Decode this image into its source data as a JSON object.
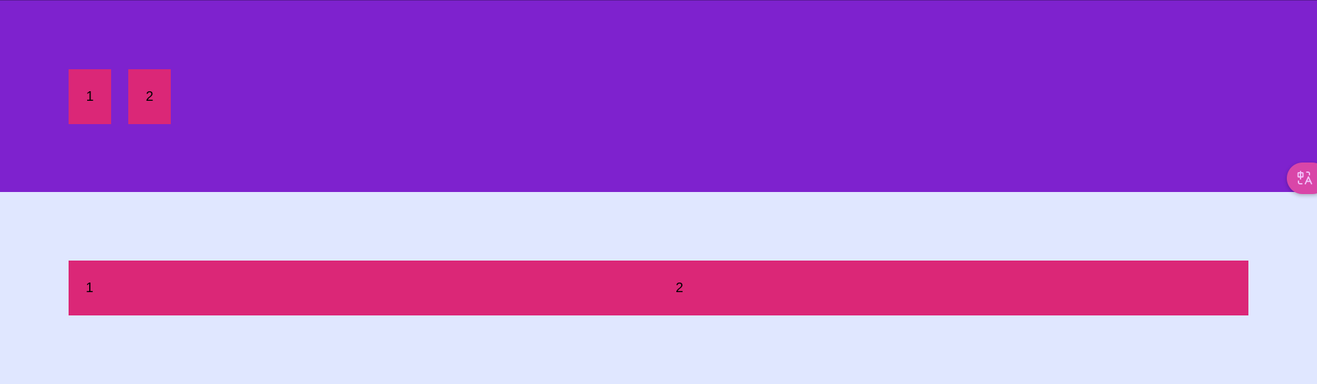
{
  "top_section": {
    "items": [
      {
        "label": "1"
      },
      {
        "label": "2"
      }
    ]
  },
  "bottom_section": {
    "items": [
      {
        "label": "1"
      },
      {
        "label": "2"
      }
    ]
  },
  "colors": {
    "top_background": "#7e22ce",
    "bottom_background": "#e0e7ff",
    "box_fill": "#db2777",
    "fab_fill": "#d946a8"
  },
  "icons": {
    "floating_button": "translate-icon"
  }
}
